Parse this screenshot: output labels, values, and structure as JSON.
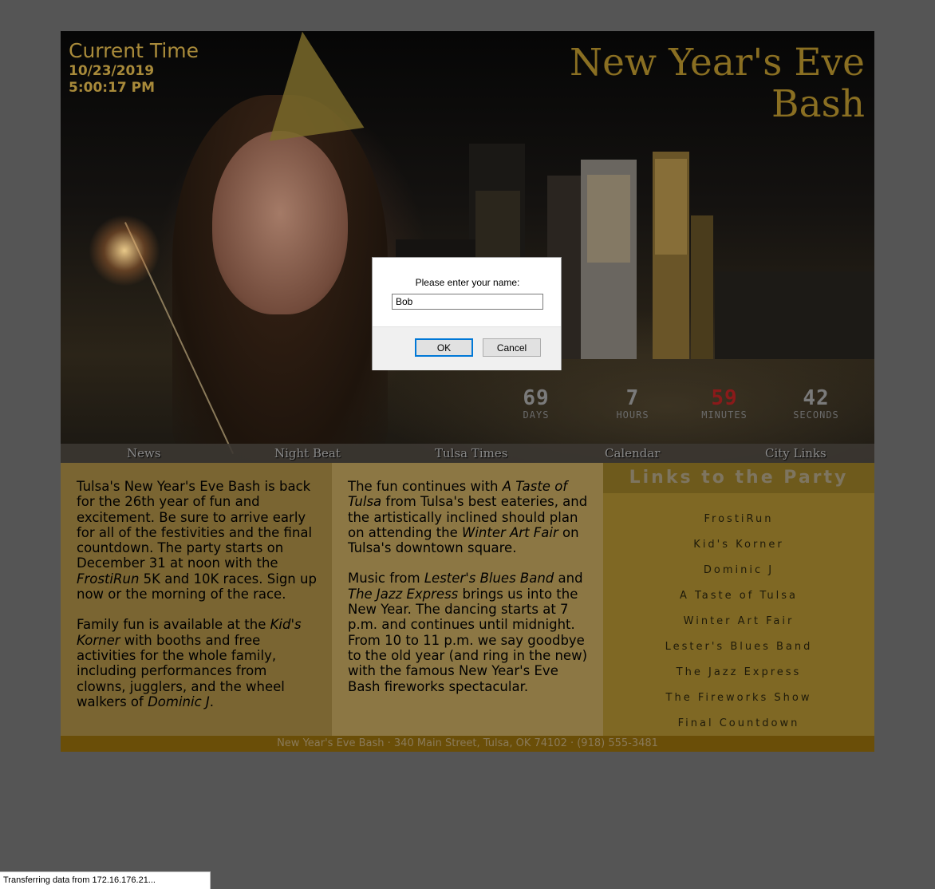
{
  "header": {
    "current_time_label": "Current Time",
    "date": "10/23/2019",
    "time": "5:00:17 PM",
    "site_title": "New Year's Eve Bash"
  },
  "countdown": [
    {
      "value": "69",
      "unit": "DAYS"
    },
    {
      "value": "7",
      "unit": "HOURS"
    },
    {
      "value": "59",
      "unit": "MINUTES"
    },
    {
      "value": "42",
      "unit": "SECONDS"
    }
  ],
  "nav": [
    "News",
    "Night Beat",
    "Tulsa Times",
    "Calendar",
    "City Links"
  ],
  "col1": {
    "p1_a": "Tulsa's New Year's Eve Bash is back for the 26th year of fun and excitement. Be sure to arrive early for all of the festivities and the final countdown. The party starts on December 31 at noon with the ",
    "p1_em": "FrostiRun",
    "p1_b": " 5K and 10K races. Sign up now or the morning of the race.",
    "p2_a": "Family fun is available at the ",
    "p2_em1": "Kid's Korner",
    "p2_b": " with booths and free activities for the whole family, including performances from clowns, jugglers, and the wheel walkers of ",
    "p2_em2": "Dominic J",
    "p2_c": "."
  },
  "col2": {
    "p1_a": "The fun continues with ",
    "p1_em1": "A Taste of Tulsa",
    "p1_b": " from Tulsa's best eateries, and the artistically inclined should plan on attending the ",
    "p1_em2": "Winter Art Fair",
    "p1_c": " on Tulsa's downtown square.",
    "p2_a": "Music from ",
    "p2_em1": "Lester's Blues Band",
    "p2_b": " and ",
    "p2_em2": "The Jazz Express",
    "p2_c": " brings us into the New Year. The dancing starts at 7 p.m. and continues until midnight. From 10 to 11 p.m. we say goodbye to the old year (and ring in the new) with the famous New Year's Eve Bash fireworks spectacular."
  },
  "links": {
    "heading": "Links to the Party",
    "items": [
      "FrostiRun",
      "Kid's Korner",
      "Dominic J",
      "A Taste of Tulsa",
      "Winter Art Fair",
      "Lester's Blues Band",
      "The Jazz Express",
      "The Fireworks Show",
      "Final Countdown"
    ]
  },
  "footer": "New Year's Eve Bash · 340 Main Street, Tulsa, OK 74102 · (918) 555-3481",
  "dialog": {
    "message": "Please enter your name:",
    "input_value": "Bob",
    "ok_label": "OK",
    "cancel_label": "Cancel"
  },
  "status_bar": "Transferring data from 172.16.176.21..."
}
